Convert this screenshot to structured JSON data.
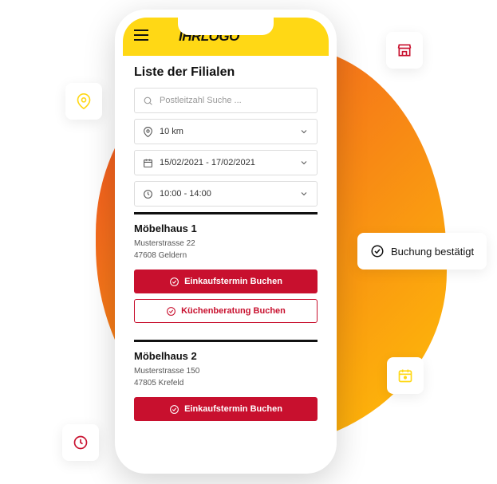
{
  "header": {
    "logo": "IHRLOGO"
  },
  "page": {
    "title": "Liste der Filialen"
  },
  "search": {
    "placeholder": "Postleitzahl Suche ..."
  },
  "filters": {
    "radius": "10 km",
    "dates": "15/02/2021 - 17/02/2021",
    "time": "10:00 - 14:00"
  },
  "stores": [
    {
      "name": "Möbelhaus 1",
      "street": "Musterstrasse 22",
      "city": "47608 Geldern",
      "primary": "Einkaufstermin Buchen",
      "secondary": "Küchenberatung Buchen"
    },
    {
      "name": "Möbelhaus 2",
      "street": "Musterstrasse 150",
      "city": "47805 Krefeld",
      "primary": "Einkaufstermin Buchen"
    }
  ],
  "confirmation": {
    "label": "Buchung bestätigt"
  }
}
